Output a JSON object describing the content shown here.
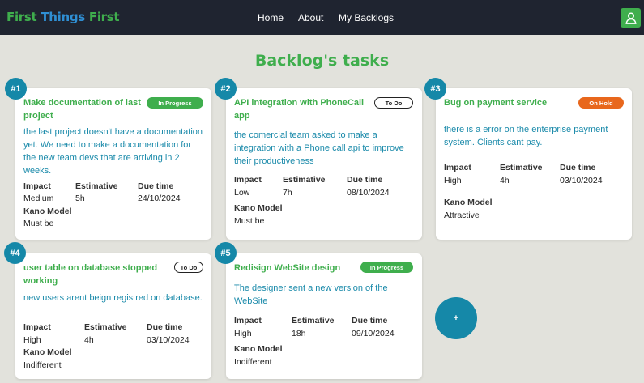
{
  "nav": {
    "brand": [
      "First",
      "Things",
      "First"
    ],
    "links": [
      "Home",
      "About",
      "My Backlogs"
    ],
    "user_icon": "user-icon"
  },
  "page": {
    "title": "Backlog's tasks"
  },
  "labels": {
    "impact": "Impact",
    "estimative": "Estimative",
    "due": "Due time",
    "kano": "Kano Model"
  },
  "tasks": [
    {
      "num": "#1",
      "title": "Make documentation of last project",
      "status": "In Progress",
      "description": "the last project doesn't have a documentation yet. We need to make a documentation for the new team devs that are arriving in 2 weeks.",
      "impact": "Medium",
      "estimative": "5h",
      "due": "24/10/2024",
      "kano": "Must be"
    },
    {
      "num": "#2",
      "title": "API integration with PhoneCall app",
      "status": "To Do",
      "description": "the comercial team asked to make a integration with a Phone call api to improve their productiveness",
      "impact": "Low",
      "estimative": "7h",
      "due": "08/10/2024",
      "kano": "Must be"
    },
    {
      "num": "#3",
      "title": "Bug on payment service",
      "status": "On Hold",
      "description": "there is a error on the enterprise payment system. Clients cant pay.",
      "impact": "High",
      "estimative": "4h",
      "due": "03/10/2024",
      "kano": "Attractive"
    },
    {
      "num": "#4",
      "title": "user table on database stopped working",
      "status": "To Do",
      "description": "new users arent beign registred on database.",
      "impact": "High",
      "estimative": "4h",
      "due": "03/10/2024",
      "kano": "Indifferent"
    },
    {
      "num": "#5",
      "title": "Redisign WebSite design",
      "status": "In Progress",
      "description": "The designer sent a new version of the WebSite",
      "impact": "High",
      "estimative": "18h",
      "due": "09/10/2024",
      "kano": "Indifferent"
    }
  ],
  "fab": {
    "label": "+"
  },
  "colors": {
    "primary_green": "#3fae4d",
    "teal": "#1588a8",
    "on_hold": "#e8671c",
    "navbar": "#1f2430"
  }
}
